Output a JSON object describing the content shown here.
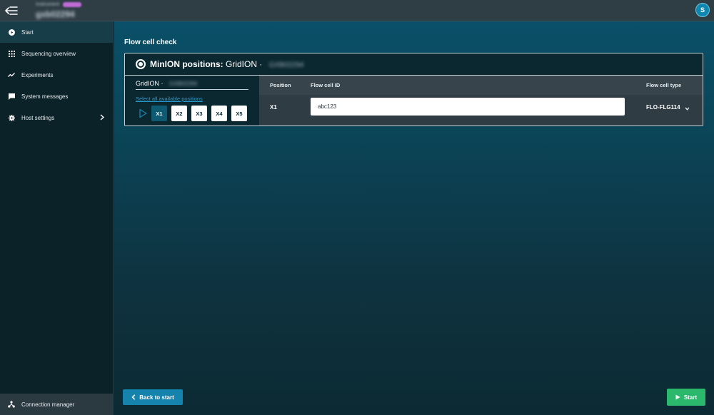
{
  "topbar": {
    "host_label_small": "Instrument",
    "host_name": "gxb02294",
    "user_initial": "S",
    "colors": {
      "background": "#2f3d45",
      "badge": "#c06bd6",
      "avatar": "#0f87b0"
    }
  },
  "sidebar": {
    "items": [
      {
        "label": "Start",
        "icon": "play-circle-icon",
        "active": true
      },
      {
        "label": "Sequencing overview",
        "icon": "grid-icon",
        "active": false
      },
      {
        "label": "Experiments",
        "icon": "trend-line-icon",
        "active": false
      },
      {
        "label": "System messages",
        "icon": "message-icon",
        "active": false
      },
      {
        "label": "Host settings",
        "icon": "gear-icon",
        "active": false,
        "has_submenu": true
      }
    ],
    "connection_manager": {
      "label": "Connection manager",
      "icon": "network-icon"
    }
  },
  "main": {
    "title": "Flow cell check",
    "card": {
      "title_bold": "MinION positions:",
      "title_device": "GridION ·",
      "title_serial": "GXB02294",
      "left_panel": {
        "device_label": "GridION ·",
        "device_serial": "GXB02294",
        "select_all": "Select all available positions",
        "positions": [
          {
            "label": "X1",
            "selected": true
          },
          {
            "label": "X2",
            "selected": false
          },
          {
            "label": "X3",
            "selected": false
          },
          {
            "label": "X4",
            "selected": false
          },
          {
            "label": "X5",
            "selected": false
          }
        ]
      },
      "table": {
        "headers": {
          "position": "Position",
          "flow_cell_id": "Flow cell ID",
          "flow_cell_type": "Flow cell type"
        },
        "rows": [
          {
            "position": "X1",
            "flow_cell_id": "abc123",
            "flow_cell_type": "FLO-FLG114"
          }
        ]
      }
    },
    "buttons": {
      "back": "Back to start",
      "start": "Start"
    },
    "colors": {
      "accent_blue": "#1583ad",
      "start_green": "#2bb86d",
      "link": "#2a9bd0"
    }
  }
}
